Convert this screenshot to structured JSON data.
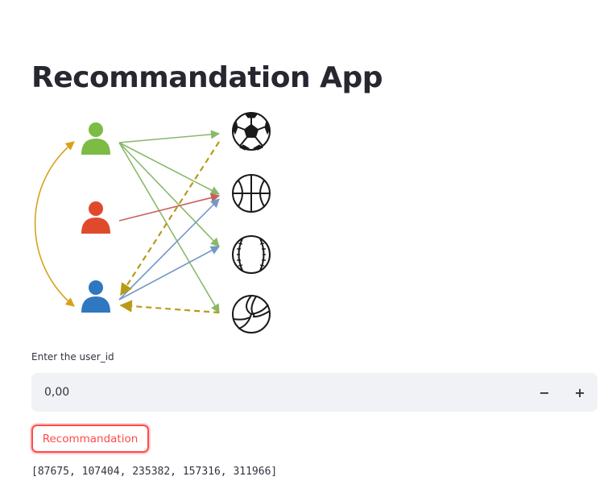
{
  "app": {
    "title": "Recommandation App"
  },
  "diagram": {
    "users": [
      {
        "name": "user-green",
        "color": "#7cbb44"
      },
      {
        "name": "user-red",
        "color": "#e04a2c"
      },
      {
        "name": "user-blue",
        "color": "#2f77c0"
      }
    ],
    "items": [
      {
        "name": "soccer-ball-icon"
      },
      {
        "name": "basketball-icon"
      },
      {
        "name": "baseball-icon"
      },
      {
        "name": "volleyball-icon"
      }
    ],
    "colors": {
      "green_edge": "#8ab86a",
      "red_edge": "#c9605a",
      "blue_edge": "#7399c6",
      "similarity": "#d4a31c",
      "recommend": "#b89a18",
      "ball_stroke": "#1a1a1a"
    }
  },
  "form": {
    "user_id_label": "Enter the user_id",
    "user_id_value": "0,00",
    "decrement_label": "−",
    "increment_label": "+",
    "button_label": "Recommandation",
    "accent": "#ff4b4b",
    "input_bg": "#f0f2f6"
  },
  "result": {
    "text": "[87675, 107404, 235382, 157316, 311966]"
  }
}
